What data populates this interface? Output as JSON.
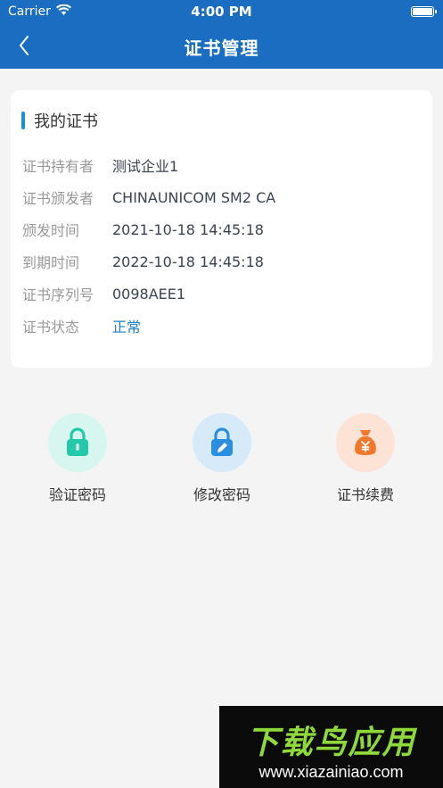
{
  "status_bar": {
    "carrier": "Carrier",
    "time": "4:00 PM"
  },
  "nav": {
    "title": "证书管理"
  },
  "certificate": {
    "section_title": "我的证书",
    "rows": [
      {
        "label": "证书持有者",
        "value": "测试企业1"
      },
      {
        "label": "证书颁发者",
        "value": "CHINAUNICOM SM2 CA"
      },
      {
        "label": "颁发时间",
        "value": "2021-10-18 14:45:18"
      },
      {
        "label": "到期时间",
        "value": "2022-10-18 14:45:18"
      },
      {
        "label": "证书序列号",
        "value": "0098AEE1"
      },
      {
        "label": "证书状态",
        "value": "正常"
      }
    ]
  },
  "actions": [
    {
      "label": "验证密码",
      "icon": "lock-icon",
      "color": "#23c9a8"
    },
    {
      "label": "修改密码",
      "icon": "lock-edit-icon",
      "color": "#2a8fe0"
    },
    {
      "label": "证书续费",
      "icon": "money-bag-icon",
      "color": "#f0782d"
    }
  ],
  "watermark": {
    "title": "下载鸟应用",
    "url": "www.xiazainiao.com"
  }
}
